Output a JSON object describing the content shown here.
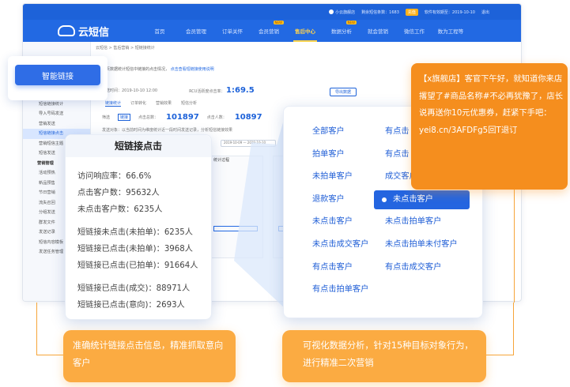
{
  "app": {
    "logo_text": "云短信",
    "topbar": {
      "user": "小云旗舰店",
      "balance_label": "剩余短信条数：1683",
      "recharge": "充值",
      "login_info": "软件有效期至：2019-10-10",
      "exit": "退出"
    },
    "nav": [
      {
        "label": "首页",
        "active": false,
        "hot": ""
      },
      {
        "label": "会员管理",
        "active": false,
        "hot": ""
      },
      {
        "label": "订单关怀",
        "active": false,
        "hot": ""
      },
      {
        "label": "会员营销",
        "active": false,
        "hot": "NEW"
      },
      {
        "label": "售后中心",
        "active": true,
        "hot": ""
      },
      {
        "label": "数据分析",
        "active": false,
        "hot": "NEW"
      },
      {
        "label": "就会营销",
        "active": false,
        "hot": ""
      },
      {
        "label": "微信工作",
        "active": false,
        "hot": ""
      },
      {
        "label": "数为工程等",
        "active": false,
        "hot": ""
      }
    ],
    "sidebar": [
      {
        "label": "智能链接",
        "kind": "group"
      },
      {
        "label": "短信链接统计",
        "kind": "item"
      },
      {
        "label": "导入号码发送",
        "kind": "item"
      },
      {
        "label": "营销发送",
        "kind": "item"
      },
      {
        "label": "短信链接点击",
        "kind": "current"
      },
      {
        "label": "营销短信主题",
        "kind": "item"
      },
      {
        "label": "短信发送",
        "kind": "item"
      },
      {
        "label": "营销管理",
        "kind": "group"
      },
      {
        "label": "活动预热",
        "kind": "item"
      },
      {
        "label": "新品预售",
        "kind": "item"
      },
      {
        "label": "节日营销",
        "kind": "item"
      },
      {
        "label": "流失召回",
        "kind": "item"
      },
      {
        "label": "分组发送",
        "kind": "item"
      },
      {
        "label": "群发文件",
        "kind": "item"
      },
      {
        "label": "发送记录",
        "kind": "item"
      },
      {
        "label": "短信内容模板",
        "kind": "item"
      },
      {
        "label": "发送任务管理",
        "kind": "item"
      }
    ],
    "content": {
      "breadcrumb": "云短信 > 售后营销 > 短链接统计",
      "notice_text": "本页数据统计短信中链接的点击情况，",
      "notice_link": "点击查看短链接使用说明",
      "send_time_label": "发送时间：2019-10-10 12:00",
      "rate_label": "RCU活跃度点击率：",
      "rate_value": "1:69.5",
      "export_button": "导出数据",
      "tabs": [
        "链接统计",
        "订单转化",
        "营销效果",
        "短信分析"
      ],
      "filter_label": "筛选",
      "filter_tag": "链接",
      "clicks_label": "点击总数：",
      "clicks_value": "101897",
      "people_label": "点击人数：",
      "people_value": "10897",
      "hint_text": "发送对象：以当前时间为维度统计近一段时间发送记录，分析短信链接效果",
      "date_range": "2019-10-09 — 2019-10-10"
    },
    "panel_title": "统计过程"
  },
  "smart_link": {
    "label": "智能链接"
  },
  "stats": {
    "title": "短链接点击",
    "rows": [
      "访问响应率：66.6%",
      "点击客户数：95632人",
      "未点击客户数：6235人",
      "短链接未点击(未拍单)：6235人",
      "短链接已点击(未拍单)：3968人",
      "短链接已点击(已拍单)：91664人",
      "短链接已点击(成交)：88971人",
      "短链接已点击(意向)：2693人"
    ]
  },
  "targets": {
    "options": [
      "全部客户",
      "有点击",
      "拍单客户",
      "有点击",
      "未拍单客户",
      "成交客户",
      "退款客户",
      "未点击客户",
      "未点击客户",
      "未点击拍单客户",
      "未点击成交客户",
      "未点击拍单未付客户",
      "有点击客户",
      "有点击成交客户",
      "有点击拍单客户"
    ],
    "selected": "未点击客户"
  },
  "sms": {
    "text": "【x旗舰店】客官下午好，就知道你来店撂望了#商品名称#不必再犹豫了，店长说再送你10元优惠券，赶紧下手吧：yei8.cn/3AFDFg5回T退订"
  },
  "callouts": {
    "left": "准确统计链接点击信息，精准抓取意向客户",
    "right": "可视化数据分析，针对15种目标对象行为，进行精准二次营销"
  },
  "colors": {
    "brand_blue": "#2269e3",
    "accent_orange": "#f58e1e",
    "callout_orange": "#fbab42",
    "nav_active": "#ffd34d"
  }
}
